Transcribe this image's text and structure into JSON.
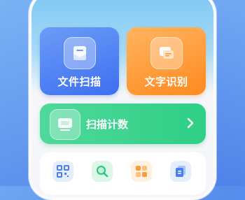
{
  "home": {
    "cards": {
      "scan_label": "文件扫描",
      "text_label": "文字识别"
    },
    "count_card": {
      "label": "扫描计数"
    },
    "tools": [
      "qr-code-icon",
      "search-icon",
      "grid-icon",
      "documents-icon"
    ]
  },
  "colors": {
    "scan_card": "#3e6ff0",
    "text_card": "#ff8a20",
    "count_card": "#2fcf86",
    "background": "#5d93ee"
  }
}
